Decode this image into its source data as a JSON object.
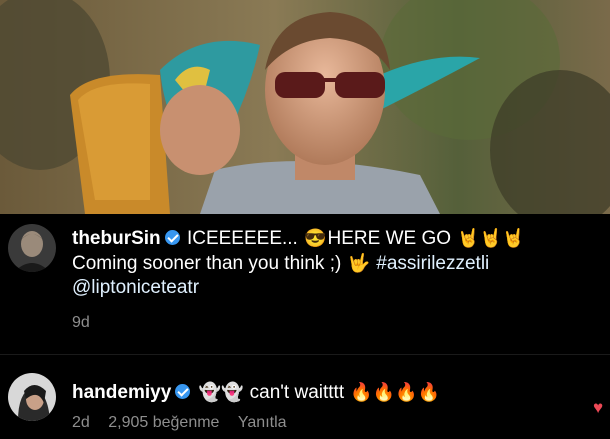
{
  "post": {
    "author": "theburSin",
    "caption_line1_text": "ICEEEEEE...",
    "caption_line1_emoji1": "😎",
    "caption_line1_text2": "HERE WE GO",
    "caption_line1_emoji2": "🤘🤘🤘",
    "caption_line2_text": "Coming sooner than you think ;)",
    "caption_line2_emoji": "🤟",
    "hashtag": "#assirilezzetli",
    "mention": "@liptoniceteatr",
    "time": "9d"
  },
  "comment": {
    "author": "handemiyy",
    "emoji1": "👻👻",
    "text": "can't waitttt",
    "emoji2": "🔥🔥🔥🔥",
    "time": "2d",
    "likes": "2,905 beğenme",
    "reply": "Yanıtla"
  },
  "colors": {
    "verified": "#3897f0",
    "meta_text": "#8e8e8e",
    "like_heart": "#ed4956"
  }
}
